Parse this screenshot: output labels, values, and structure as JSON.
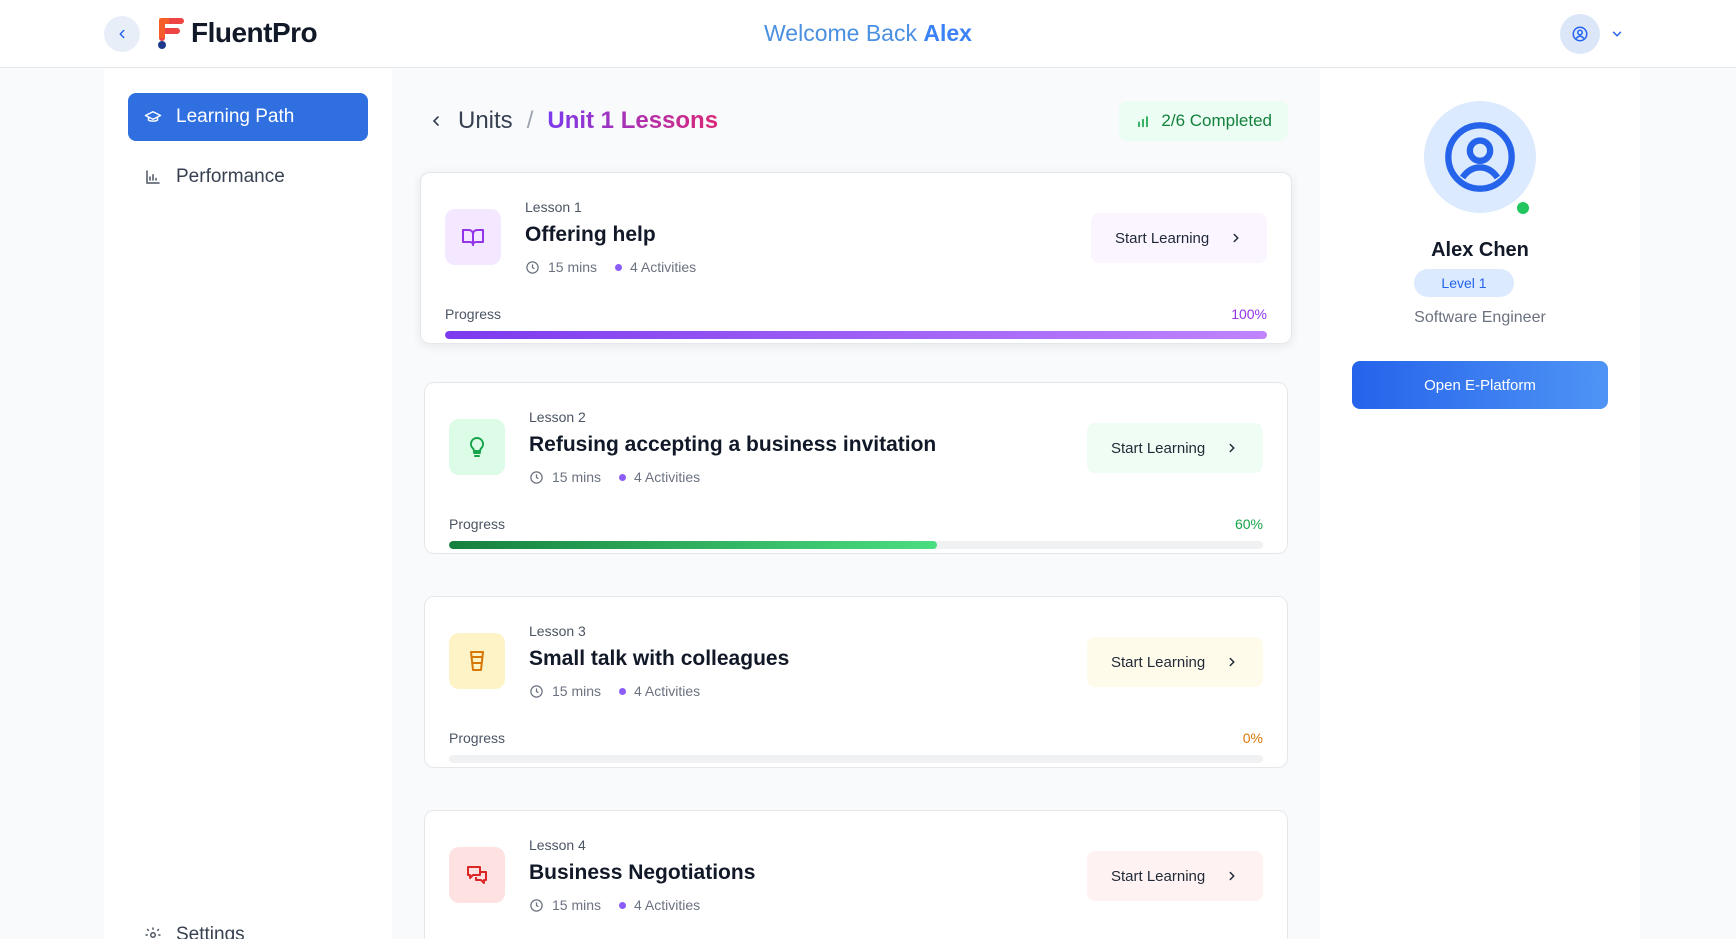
{
  "header": {
    "app_name": "FluentPro",
    "welcome_prefix": "Welcome Back",
    "welcome_name": "Alex"
  },
  "sidebar": {
    "items": [
      {
        "label": "Learning Path",
        "icon": "graduation-cap-icon",
        "active": true
      },
      {
        "label": "Performance",
        "icon": "bar-chart-icon",
        "active": false
      }
    ],
    "settings_label": "Settings"
  },
  "main": {
    "breadcrumb": {
      "parent": "Units",
      "separator": "/",
      "current": "Unit 1 Lessons"
    },
    "completed_badge": "2/6 Completed",
    "progress_label": "Progress",
    "lessons": [
      {
        "number": "Lesson 1",
        "title": "Offering help",
        "duration": "15 mins",
        "activities": "4 Activities",
        "button": "Start Learning",
        "progress_text": "100%",
        "progress": 100,
        "icon": "book-icon",
        "accent": "#9333ea"
      },
      {
        "number": "Lesson 2",
        "title": "Refusing accepting a business invitation",
        "duration": "15 mins",
        "activities": "4 Activities",
        "button": "Start Learning",
        "progress_text": "60%",
        "progress": 60,
        "icon": "lightbulb-icon",
        "accent": "#16a34a"
      },
      {
        "number": "Lesson 3",
        "title": "Small talk with colleagues",
        "duration": "15 mins",
        "activities": "4 Activities",
        "button": "Start Learning",
        "progress_text": "0%",
        "progress": 0,
        "icon": "cup-icon",
        "accent": "#d97706"
      },
      {
        "number": "Lesson 4",
        "title": "Business Negotiations",
        "duration": "15 mins",
        "activities": "4 Activities",
        "button": "Start Learning",
        "progress_text": "",
        "progress": null,
        "icon": "chat-bubbles-icon",
        "accent": "#dc2626"
      }
    ]
  },
  "profile": {
    "name": "Alex Chen",
    "level": "Level 1",
    "role": "Software Engineer",
    "button": "Open E-Platform",
    "status": "online"
  },
  "colors": {
    "primary": "#2f6fdf",
    "purple": "#9333ea",
    "green": "#16a34a",
    "amber": "#d97706",
    "red": "#dc2626"
  }
}
